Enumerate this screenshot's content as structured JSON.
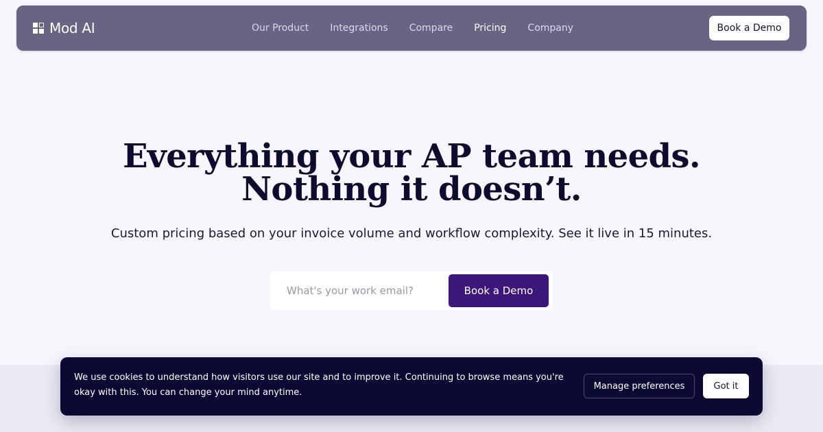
{
  "nav": {
    "logo_text": "Mod AI",
    "links": [
      {
        "label": "Our Product"
      },
      {
        "label": "Integrations"
      },
      {
        "label": "Compare"
      },
      {
        "label": "Pricing"
      },
      {
        "label": "Company"
      }
    ],
    "active_link": "Pricing",
    "cta_label": "Book a Demo"
  },
  "hero": {
    "title_line1": "Everything your AP team needs.",
    "title_line2": "Nothing it doesn’t.",
    "subtitle": "Custom pricing based on your invoice volume and workflow complexity. See it live in 15 minutes.",
    "email_placeholder": "What's your work email?",
    "email_value": "",
    "cta_label": "Book a Demo"
  },
  "cookie_banner": {
    "message": "We use cookies to understand how visitors use our site and to improve it. Continuing to browse means you're okay with this. You can change your mind anytime.",
    "manage_label": "Manage preferences",
    "accept_label": "Got it"
  },
  "colors": {
    "nav_bg": "#686484",
    "page_bg": "#f7f6fd",
    "primary": "#3c1678",
    "banner_bg": "#0b0a32",
    "heading": "#0d0b2e"
  }
}
